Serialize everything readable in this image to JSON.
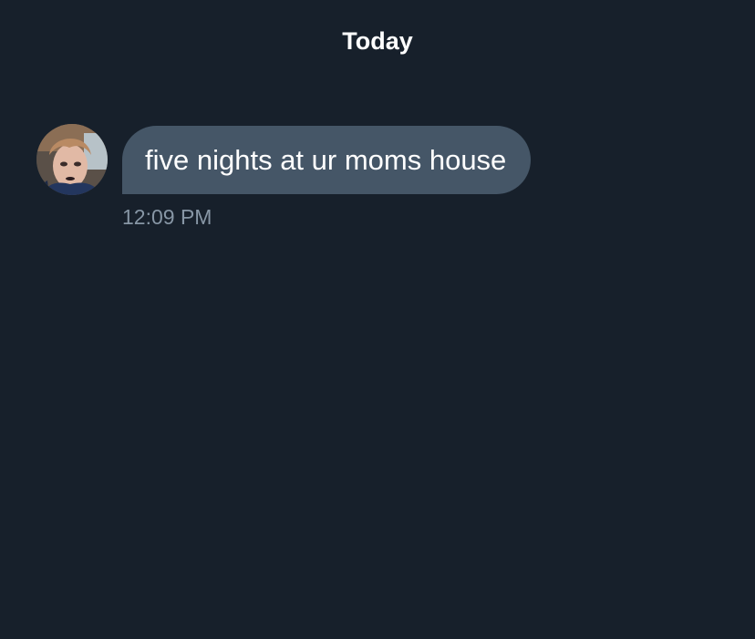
{
  "conversation": {
    "date_divider": "Today",
    "messages": [
      {
        "text": "five nights at ur moms house",
        "time": "12:09 PM",
        "avatar": "user-avatar-photo"
      }
    ]
  },
  "colors": {
    "background": "#17202b",
    "bubble": "#455667",
    "timestamp": "#8796a5",
    "text": "#ffffff"
  }
}
